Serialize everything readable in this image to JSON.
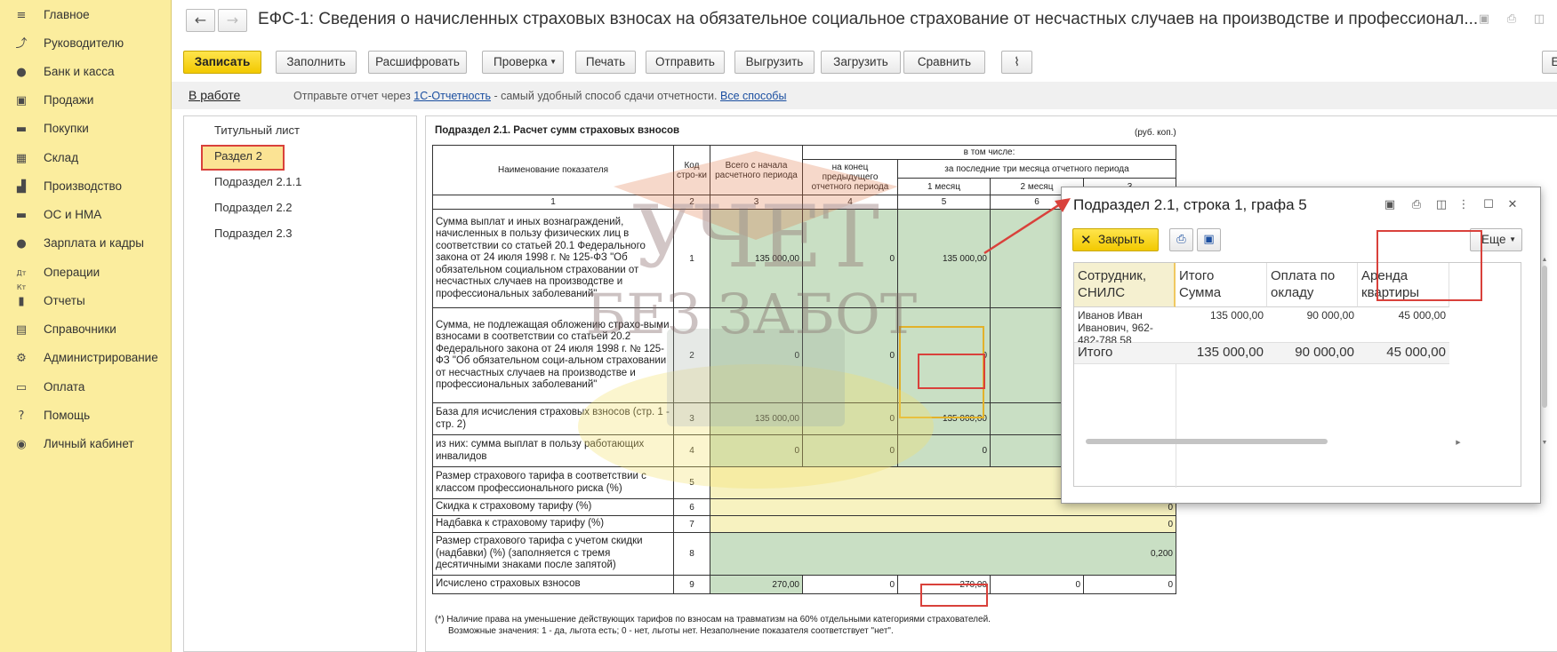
{
  "sidebar": {
    "items": [
      {
        "label": "Главное",
        "icon": "menu-icon"
      },
      {
        "label": "Руководителю",
        "icon": "trend-icon"
      },
      {
        "label": "Банк и касса",
        "icon": "ruble-icon"
      },
      {
        "label": "Продажи",
        "icon": "bag-icon"
      },
      {
        "label": "Покупки",
        "icon": "cart-icon"
      },
      {
        "label": "Склад",
        "icon": "grid-icon"
      },
      {
        "label": "Производство",
        "icon": "factory-icon"
      },
      {
        "label": "ОС и НМА",
        "icon": "truck-icon"
      },
      {
        "label": "Зарплата и кадры",
        "icon": "person-icon"
      },
      {
        "label": "Операции",
        "icon": "dt-kt-icon"
      },
      {
        "label": "Отчеты",
        "icon": "barchart-icon"
      },
      {
        "label": "Справочники",
        "icon": "books-icon"
      },
      {
        "label": "Администрирование",
        "icon": "gear-icon"
      },
      {
        "label": "Оплата",
        "icon": "wallet-icon"
      },
      {
        "label": "Помощь",
        "icon": "question-icon"
      },
      {
        "label": "Личный кабинет",
        "icon": "account-icon"
      }
    ]
  },
  "header": {
    "back": "←",
    "forward": "→",
    "title": "ЕФС-1: Сведения о начисленных страховых взносах на обязательное социальное страхование от несчастных случаев на производстве и профессионал..."
  },
  "toolbar": {
    "save": "Записать",
    "fill": "Заполнить",
    "decode": "Расшифровать",
    "check": "Проверка",
    "print": "Печать",
    "send": "Отправить",
    "upload": "Выгрузить",
    "load": "Загрузить",
    "compare": "Сравнить",
    "right_btn": "Е"
  },
  "infobar": {
    "status": "В работе",
    "text1": "Отправьте отчет через ",
    "link1": "1С-Отчетность",
    "text2": " - самый удобный способ сдачи отчетности. ",
    "link2": "Все способы"
  },
  "tree": {
    "items": [
      "Титульный лист",
      "Раздел 2",
      "Подраздел 2.1.1",
      "Подраздел 2.2",
      "Подраздел 2.3"
    ]
  },
  "report": {
    "title": "Подраздел 2.1. Расчет сумм страховых взносов",
    "unit": "(руб. коп.)",
    "headers": {
      "name": "Наименование показателя",
      "code": "Код стро-ки",
      "total": "Всего с начала расчетного периода",
      "prev": "на конец предыдущего отчетного периода",
      "incl": "в том числе:",
      "last3": "за последние три месяца отчетного периода",
      "m1": "1 месяц",
      "m2": "2 месяц",
      "m3": "3",
      "n1": "1",
      "n2": "2",
      "n3": "3",
      "n4": "4",
      "n5": "5",
      "n6": "6"
    },
    "rows": [
      {
        "name": "Сумма выплат и иных вознаграждений, начисленных в пользу физических лиц в соответствии со статьей 20.1 Федерального закона от 24 июля 1998 г. № 125-ФЗ \"Об обязательном социальном страховании от несчастных случаев на производстве и профессиональных заболеваний\"",
        "code": "1",
        "total": "135 000,00",
        "prev": "0",
        "m1": "135 000,00",
        "m2": ""
      },
      {
        "name": "Сумма, не подлежащая обложению страхо-выми взносами в соответствии со статьей 20.2 Федерального закона от 24 июля 1998 г. № 125-ФЗ \"Об обязательном соци-альном страховании от несчастных случаев на производстве и профессиональных заболеваний\"",
        "code": "2",
        "total": "0",
        "prev": "0",
        "m1": "0",
        "m2": ""
      },
      {
        "name": "База для исчисления страховых взносов (стр. 1 - стр. 2)",
        "code": "3",
        "total": "135 000,00",
        "prev": "0",
        "m1": "135 000,00",
        "m2": ""
      },
      {
        "name": "из них: сумма выплат в пользу работающих инвалидов",
        "code": "4",
        "total": "0",
        "prev": "0",
        "m1": "0",
        "m2": ""
      },
      {
        "name": "Размер страхового тарифа в соответствии с классом профессионального риска (%)",
        "code": "5",
        "value": ""
      },
      {
        "name": "Скидка к страховому тарифу (%)",
        "code": "6",
        "value": "0"
      },
      {
        "name": "Надбавка к страховому тарифу (%)",
        "code": "7",
        "value": "0"
      },
      {
        "name": "Размер страхового тарифа с учетом скидки (надбавки) (%) (заполняется с тремя десятичными знаками после запятой)",
        "code": "8",
        "value": "0,200"
      },
      {
        "name": "Исчислено страховых взносов",
        "code": "9",
        "total": "270,00",
        "prev": "0",
        "m1": "270,00",
        "m2": "0",
        "m3": "0"
      }
    ],
    "note1": "(*) Наличие права на уменьшение действующих тарифов по взносам на травматизм на 60% отдельными категориями страхователей.",
    "note2": "Возможные значения: 1 - да, льгота есть; 0 - нет, льготы нет. Незаполнение показателя соответствует \"нет\"."
  },
  "popup": {
    "title": "Подраздел 2.1, строка 1, графа 5",
    "close": "Закрыть",
    "more": "Еще",
    "columns": {
      "employee": "Сотрудник, СНИЛС",
      "total_1": "Итого",
      "total_2": "Сумма",
      "salary": "Оплата по окладу",
      "rent": "Аренда квартиры"
    },
    "rows": [
      {
        "employee": "Иванов Иван Иванович, 962-482-788 58",
        "total": "135 000,00",
        "salary": "90 000,00",
        "rent": "45 000,00"
      }
    ],
    "totals": {
      "label": "Итого",
      "total": "135 000,00",
      "salary": "90 000,00",
      "rent": "45 000,00"
    }
  },
  "watermark": {
    "line1": "УЧЕТ",
    "line2": "БЕЗ ЗАБОТ"
  },
  "colors": {
    "sidebar_bg": "#fbed9e",
    "primary_button": "#f2c900",
    "highlight_red": "#d9413b",
    "cell_green": "#c9dfc4",
    "link_blue": "#1b4fa0"
  }
}
